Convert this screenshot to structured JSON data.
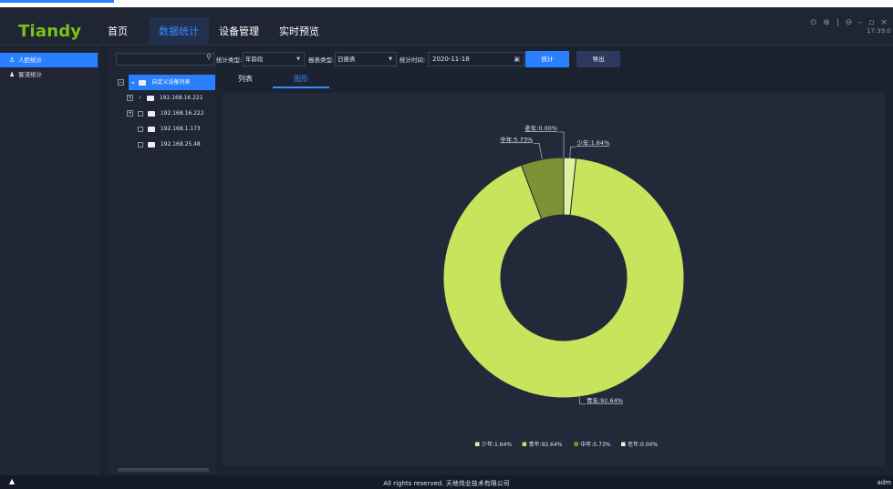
{
  "app": {
    "logo": "Tiandy"
  },
  "nav": [
    {
      "label": "首页",
      "active": false
    },
    {
      "label": "数据统计",
      "active": true
    },
    {
      "label": "设备管理",
      "active": false
    },
    {
      "label": "实时预览",
      "active": false
    }
  ],
  "window": {
    "controls": "⊙ ⊕ | ⊖ – ▫ ×",
    "clock": "17:39:0"
  },
  "sidebar": {
    "items": [
      {
        "label": "人脸统计",
        "icon": "person-icon",
        "active": true
      },
      {
        "label": "客流统计",
        "icon": "people-icon",
        "active": false
      }
    ]
  },
  "tree": {
    "search_placeholder": "",
    "root": "自定义设备列表",
    "nodes": [
      {
        "label": "192.168.16.221",
        "expandable": true,
        "checked": true
      },
      {
        "label": "192.168.16.222",
        "expandable": true,
        "checked": false
      },
      {
        "label": "192.168.1.173",
        "expandable": false,
        "checked": false
      },
      {
        "label": "192.168.25.48",
        "expandable": false,
        "checked": false
      }
    ]
  },
  "toolbar": {
    "stat_type_label": "统计类型:",
    "stat_type_value": "年龄段",
    "report_type_label": "报表类型:",
    "report_type_value": "日报表",
    "stat_time_label": "统计时间:",
    "stat_time_value": "2020-11-18",
    "stat_button": "统计",
    "export_button": "导出"
  },
  "view_tabs": [
    {
      "label": "列表",
      "active": false
    },
    {
      "label": "图形",
      "active": true
    }
  ],
  "chart_data": {
    "type": "pie",
    "donut": true,
    "slices": [
      {
        "name": "少年",
        "value": 1.64,
        "label": "少年:1.64%",
        "color": "#dff0a0"
      },
      {
        "name": "青年",
        "value": 92.64,
        "label": "青年:92.64%",
        "color": "#c8e35c"
      },
      {
        "name": "中年",
        "value": 5.73,
        "label": "中年:5.73%",
        "color": "#7f9135"
      },
      {
        "name": "老年",
        "value": 0.0,
        "label": "老年:0.00%",
        "color": "#eef3d0"
      }
    ],
    "legend": [
      "少年:1.64%",
      "青年:92.64%",
      "中年:5.73%",
      "老年:0.00%"
    ],
    "legend_position": "bottom"
  },
  "footer": {
    "copyright": "All rights reserved. 天地伟业技术有限公司",
    "user": "adm",
    "warn": "▲"
  }
}
